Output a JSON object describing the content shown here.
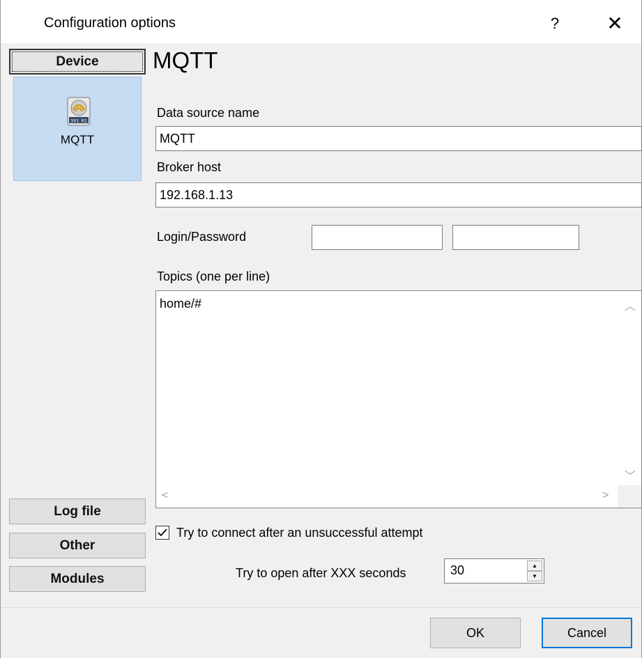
{
  "window": {
    "title": "Configuration options",
    "help_label": "?",
    "close_label": "✕"
  },
  "sidebar": {
    "device_tab": "Device",
    "devices": [
      {
        "label": "MQTT",
        "icon": "mqtt-device-icon"
      }
    ],
    "tabs": [
      "Log file",
      "Other",
      "Modules"
    ]
  },
  "panel": {
    "title": "MQTT",
    "data_source_label": "Data source name",
    "data_source_value": "MQTT",
    "broker_host_label": "Broker host",
    "broker_host_value": "192.168.1.13",
    "login_password_label": "Login/Password",
    "login_value": "",
    "password_value": "",
    "topics_label": "Topics (one per line)",
    "topics_value": "home/#",
    "reconnect_label": "Try to connect after an unsuccessful attempt",
    "reconnect_checked": true,
    "retry_label": "Try to open after XXX seconds",
    "retry_value": "30"
  },
  "footer": {
    "ok_label": "OK",
    "cancel_label": "Cancel"
  },
  "colors": {
    "selected_device_bg": "#c6dcf3",
    "default_button_border": "#0078d7"
  }
}
